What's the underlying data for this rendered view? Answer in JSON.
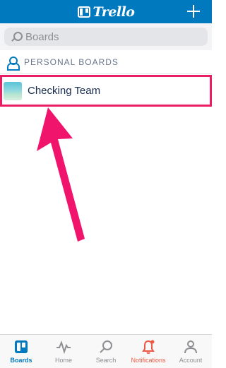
{
  "header": {
    "logo_text": "Trello",
    "add_icon": "plus-icon",
    "color": "#0079bf"
  },
  "search": {
    "placeholder": "Boards",
    "value": ""
  },
  "section": {
    "title": "PERSONAL BOARDS",
    "icon": "person-icon"
  },
  "boards": [
    {
      "name": "Checking Team",
      "highlighted": true
    }
  ],
  "annotation": {
    "highlight_color": "#e91e63",
    "arrow_color": "#f0146c"
  },
  "tabs": [
    {
      "label": "Boards",
      "icon": "boards-icon",
      "active": true
    },
    {
      "label": "Home",
      "icon": "activity-icon",
      "active": false
    },
    {
      "label": "Search",
      "icon": "search-icon",
      "active": false
    },
    {
      "label": "Notifications",
      "icon": "bell-icon",
      "active": false,
      "alert": true
    },
    {
      "label": "Account",
      "icon": "account-icon",
      "active": false
    }
  ]
}
